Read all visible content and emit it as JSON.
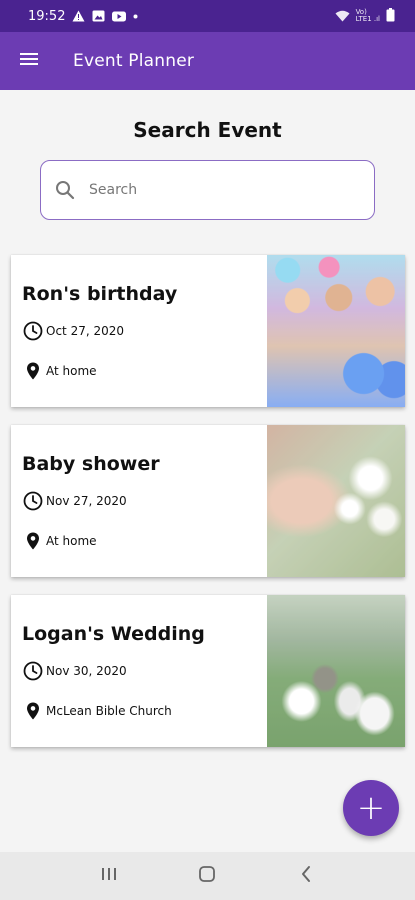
{
  "status_bar": {
    "time": "19:52",
    "network_label_top": "Vo)",
    "network_label_bottom": "LTE1 .ıl"
  },
  "app_bar": {
    "title": "Event Planner"
  },
  "page": {
    "title": "Search Event"
  },
  "search": {
    "placeholder": "Search",
    "value": ""
  },
  "events": [
    {
      "name": "Ron's birthday",
      "date": "Oct 27, 2020",
      "location": "At home"
    },
    {
      "name": "Baby shower",
      "date": "Nov 27, 2020",
      "location": "At home"
    },
    {
      "name": "Logan's Wedding",
      "date": "Nov 30, 2020",
      "location": "McLean Bible Church"
    }
  ],
  "fab": {
    "label": "+"
  },
  "colors": {
    "status_bar": "#4a2390",
    "app_bar": "#6c3cb3",
    "accent": "#6c3cb3",
    "search_border": "#8b6cc4",
    "background": "#f4f4f4"
  }
}
